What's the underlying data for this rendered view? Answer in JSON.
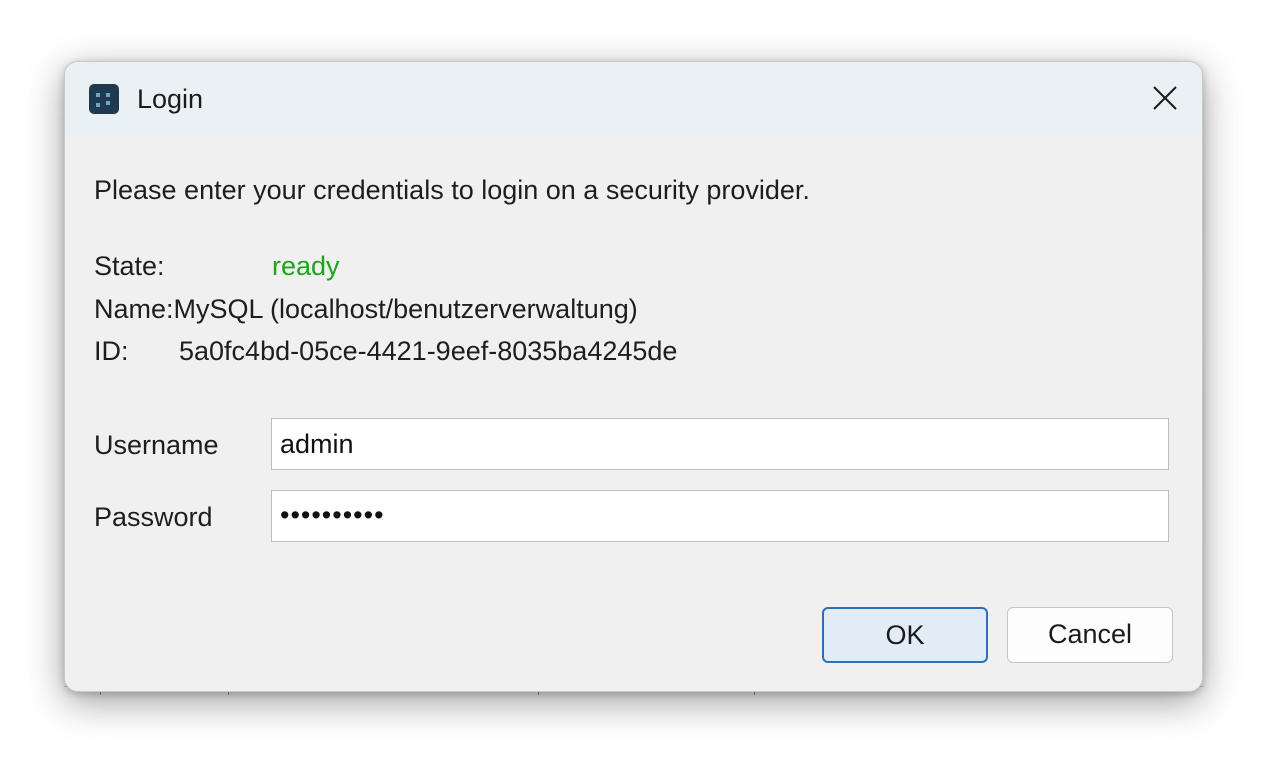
{
  "dialog": {
    "title": "Login",
    "description": "Please enter your credentials to login on a security provider.",
    "icons": {
      "app": "app-icon",
      "close": "close-icon"
    }
  },
  "provider": {
    "state_label": "State:",
    "state_value": "ready",
    "state_color": "#1aa51a",
    "name_text": "Name:MySQL (localhost/benutzerverwaltung)",
    "id_label": "ID:",
    "id_value": "5a0fc4bd-05ce-4421-9eef-8035ba4245de"
  },
  "form": {
    "username_label": "Username",
    "username_value": "admin",
    "password_label": "Password",
    "password_value": "••••••••••"
  },
  "buttons": {
    "ok_label": "OK",
    "cancel_label": "Cancel",
    "accent": "#2f6fb6"
  }
}
